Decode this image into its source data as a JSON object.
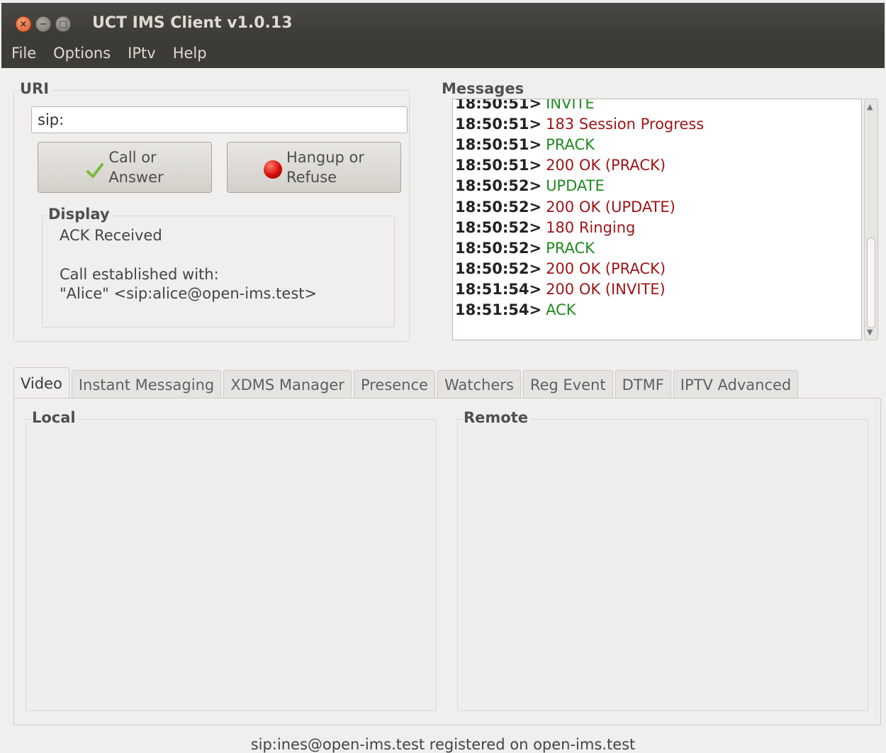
{
  "window": {
    "title": "UCT IMS Client v1.0.13",
    "close_glyph": "×",
    "min_glyph": "−",
    "max_glyph": "□"
  },
  "menu": {
    "items": [
      "File",
      "Options",
      "IPtv",
      "Help"
    ]
  },
  "uri": {
    "label": "URI",
    "value": "sip:",
    "call_button": "Call or\nAnswer",
    "hangup_button": "Hangup or\nRefuse"
  },
  "display": {
    "label": "Display",
    "line1": "ACK Received",
    "line2": "Call established with:",
    "line3": "\"Alice\" <sip:alice@open-ims.test>"
  },
  "messages": {
    "label": "Messages",
    "colors": {
      "request": "#1f8a1f",
      "response": "#9e1414"
    },
    "items": [
      {
        "time": "18:50:51>",
        "text": "INVITE",
        "kind": "green"
      },
      {
        "time": "18:50:51>",
        "text": "183 Session Progress",
        "kind": "red"
      },
      {
        "time": "18:50:51>",
        "text": "PRACK",
        "kind": "green"
      },
      {
        "time": "18:50:51>",
        "text": "200 OK (PRACK)",
        "kind": "red"
      },
      {
        "time": "18:50:52>",
        "text": "UPDATE",
        "kind": "green"
      },
      {
        "time": "18:50:52>",
        "text": "200 OK (UPDATE)",
        "kind": "red"
      },
      {
        "time": "18:50:52>",
        "text": "180 Ringing",
        "kind": "red"
      },
      {
        "time": "18:50:52>",
        "text": "PRACK",
        "kind": "green"
      },
      {
        "time": "18:50:52>",
        "text": "200 OK (PRACK)",
        "kind": "red"
      },
      {
        "time": "18:51:54>",
        "text": "200 OK (INVITE)",
        "kind": "red"
      },
      {
        "time": "18:51:54>",
        "text": "ACK",
        "kind": "green"
      }
    ]
  },
  "tabs": {
    "items": [
      "Video",
      "Instant Messaging",
      "XDMS Manager",
      "Presence",
      "Watchers",
      "Reg Event",
      "DTMF",
      "IPTV Advanced"
    ],
    "active": 0
  },
  "video": {
    "local_label": "Local",
    "remote_label": "Remote"
  },
  "status": {
    "text": "sip:ines@open-ims.test registered on open-ims.test"
  }
}
